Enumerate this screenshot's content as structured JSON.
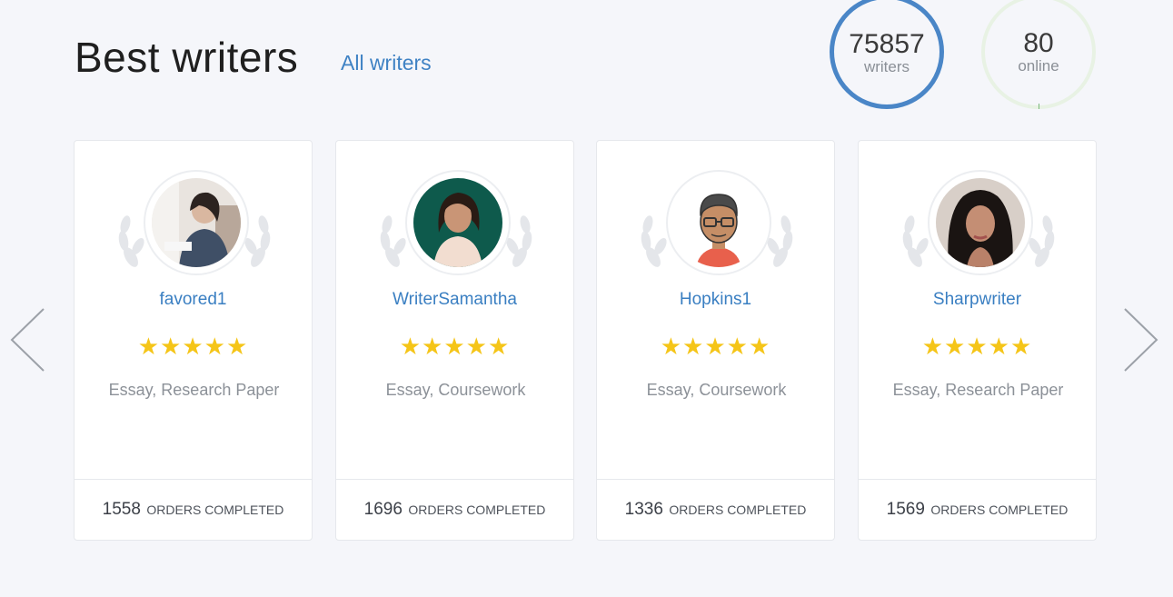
{
  "header": {
    "title": "Best writers",
    "all_link": "All writers"
  },
  "stats": {
    "writers": {
      "value": "75857",
      "label": "writers"
    },
    "online": {
      "value": "80",
      "label": "online"
    }
  },
  "colors": {
    "accent": "#3f82c4",
    "star": "#f5c518",
    "ring": "#4a86c7"
  },
  "writers": [
    {
      "name": "favored1",
      "stars": "★★★★★",
      "skills": "Essay, Research Paper",
      "orders": "1558",
      "orders_label": "ORDERS COMPLETED",
      "avatar": "photo-avatar"
    },
    {
      "name": "WriterSamantha",
      "stars": "★★★★★",
      "skills": "Essay, Coursework",
      "orders": "1696",
      "orders_label": "ORDERS COMPLETED",
      "avatar": "photo-avatar"
    },
    {
      "name": "Hopkins1",
      "stars": "★★★★★",
      "skills": "Essay, Coursework",
      "orders": "1336",
      "orders_label": "ORDERS COMPLETED",
      "avatar": "cartoon-avatar"
    },
    {
      "name": "Sharpwriter",
      "stars": "★★★★★",
      "skills": "Essay, Research Paper",
      "orders": "1569",
      "orders_label": "ORDERS COMPLETED",
      "avatar": "photo-avatar"
    }
  ]
}
